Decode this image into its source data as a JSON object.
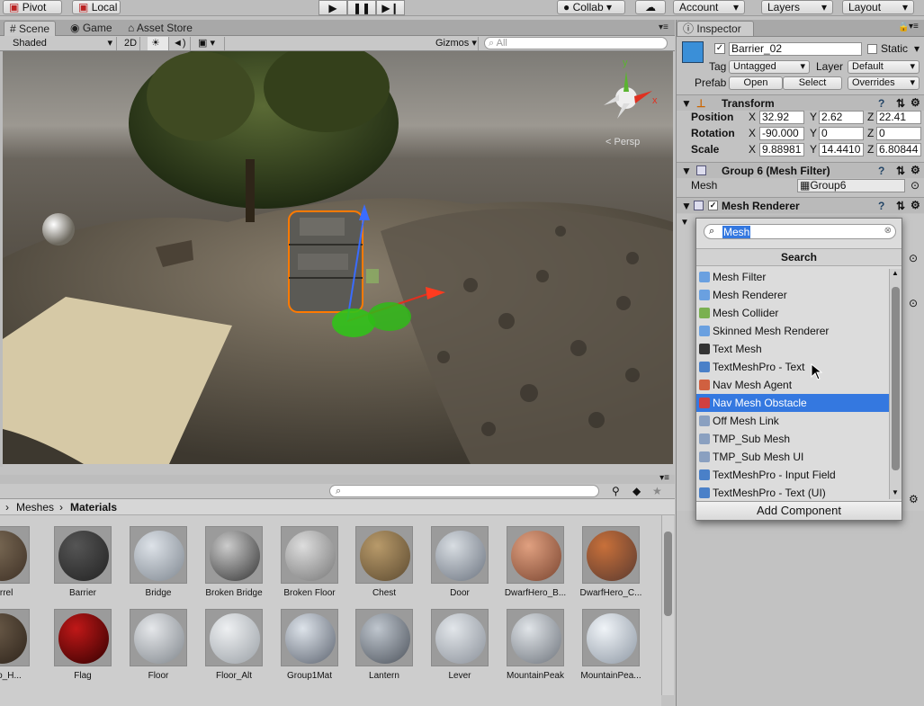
{
  "toolbar": {
    "pivot": "Pivot",
    "local": "Local",
    "play_icon": "play-icon",
    "pause_icon": "pause-icon",
    "step_icon": "step-icon",
    "collab": "Collab",
    "account": "Account",
    "layers": "Layers",
    "layout": "Layout"
  },
  "scene_tabs": {
    "scene": "Scene",
    "game": "Game",
    "asset_store": "Asset Store"
  },
  "scene_bar": {
    "shading": "Shaded",
    "mode_2d": "2D",
    "gizmos": "Gizmos",
    "search_placeholder": "All"
  },
  "scene_view": {
    "persp_label": "Persp",
    "gizmo_y": "y",
    "gizmo_x": "x"
  },
  "project": {
    "breadcrumb": [
      "Meshes",
      "Materials"
    ],
    "row1": [
      "Barrel",
      "Barrier",
      "Bridge",
      "Broken Bridge",
      "Broken Floor",
      "Chest",
      "Door",
      "DwarfHero_B...",
      "DwarfHero_C..."
    ],
    "row2": [
      "fHero_H...",
      "Flag",
      "Floor",
      "Floor_Alt",
      "Group1Mat",
      "Lantern",
      "Lever",
      "MountainPeak",
      "MountainPea..."
    ]
  },
  "inspector": {
    "tab": "Inspector",
    "object_name": "Barrier_02",
    "static_label": "Static",
    "tag_label": "Tag",
    "tag_value": "Untagged",
    "layer_label": "Layer",
    "layer_value": "Default",
    "prefab_label": "Prefab",
    "prefab_open": "Open",
    "prefab_select": "Select",
    "prefab_overrides": "Overrides",
    "transform_title": "Transform",
    "position_label": "Position",
    "rotation_label": "Rotation",
    "scale_label": "Scale",
    "axis_x": "X",
    "axis_y": "Y",
    "axis_z": "Z",
    "position": [
      "32.92",
      "2.62",
      "22.41"
    ],
    "rotation": [
      "-90.000",
      "0",
      "0"
    ],
    "scale": [
      "9.88981",
      "14.4410",
      "6.80844"
    ],
    "mesh_filter_title": "Group 6 (Mesh Filter)",
    "mesh_label": "Mesh",
    "mesh_value": "Group6",
    "mesh_renderer_title": "Mesh Renderer"
  },
  "popup": {
    "search_value": "Mesh",
    "header": "Search",
    "items": [
      "Mesh Filter",
      "Mesh Renderer",
      "Mesh Collider",
      "Skinned Mesh Renderer",
      "Text Mesh",
      "TextMeshPro - Text",
      "Nav Mesh Agent",
      "Nav Mesh Obstacle",
      "Off Mesh Link",
      "TMP_Sub Mesh",
      "TMP_Sub Mesh UI",
      "TextMeshPro - Input Field",
      "TextMeshPro - Text (UI)"
    ],
    "selected_index": 7,
    "add_component": "Add Component"
  },
  "colors": {
    "selection": "#3478e0",
    "outline": "#ff7a00"
  }
}
